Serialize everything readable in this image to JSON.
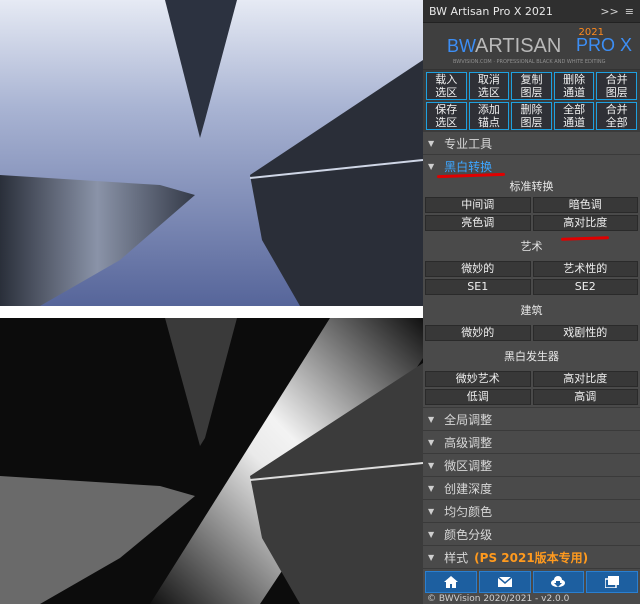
{
  "panel": {
    "title": "BW Artisan Pro X 2021",
    "window_controls": [
      ">>",
      "≡"
    ],
    "logo": {
      "bw": "BW",
      "brand": "ARTISAN",
      "prox": "PRO X",
      "year": "2021",
      "tagline": "BWVISION.COM · PROFESSIONAL BLACK AND WHITE EDITING"
    },
    "grid_buttons": [
      "载入\n选区",
      "取消\n选区",
      "复制\n图层",
      "删除\n通道",
      "合并\n图层",
      "保存\n选区",
      "添加\n锚点",
      "删除\n图层",
      "全部\n通道",
      "合并\n全部"
    ],
    "sections": {
      "pro_tools": "专业工具",
      "bw_convert": "黑白转换",
      "global_adjust": "全局调整",
      "advanced_adjust": "高级调整",
      "micro_adjust": "微区调整",
      "create_depth": "创建深度",
      "even_color": "均匀颜色",
      "color_grading": "颜色分级",
      "styles": "样式",
      "styles_note": "(PS 2021版本专用)"
    },
    "standard": {
      "heading": "标准转换",
      "buttons": [
        "中间调",
        "暗色调",
        "亮色调",
        "高对比度"
      ]
    },
    "art": {
      "heading": "艺术",
      "buttons": [
        "微妙的",
        "艺术性的",
        "SE1",
        "SE2"
      ]
    },
    "architecture": {
      "heading": "建筑",
      "buttons": [
        "微妙的",
        "戏剧性的"
      ]
    },
    "generator": {
      "heading": "黑白发生器",
      "buttons": [
        "微妙艺术",
        "高对比度",
        "低调",
        "高调"
      ]
    },
    "footer_icons": [
      "home-icon",
      "mail-icon",
      "cloud-download-icon",
      "import-icon"
    ],
    "copyright": "© BWVision 2020/2021 - v2.0.0",
    "colors": {
      "accent_blue": "#3da5ff",
      "logo_orange": "#ff8a1e",
      "annotation_red": "#e00000"
    }
  }
}
